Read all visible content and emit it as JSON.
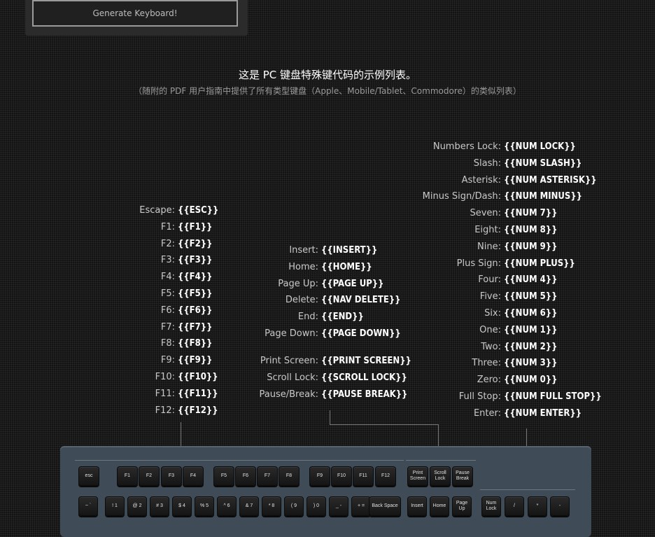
{
  "generate_button": "Generate Keyboard!",
  "headline": "这是 PC 键盘特殊键代码的示例列表。",
  "subline": "（随附的 PDF 用户指南中提供了所有类型键盘（Apple、Mobile/Tablet、Commodore）的类似列表）",
  "left_column": [
    {
      "label": "Escape:",
      "code": "{{ESC}}"
    },
    {
      "label": "F1:",
      "code": "{{F1}}"
    },
    {
      "label": "F2:",
      "code": "{{F2}}"
    },
    {
      "label": "F3:",
      "code": "{{F3}}"
    },
    {
      "label": "F4:",
      "code": "{{F4}}"
    },
    {
      "label": "F5:",
      "code": "{{F5}}"
    },
    {
      "label": "F6:",
      "code": "{{F6}}"
    },
    {
      "label": "F7:",
      "code": "{{F7}}"
    },
    {
      "label": "F8:",
      "code": "{{F8}}"
    },
    {
      "label": "F9:",
      "code": "{{F9}}"
    },
    {
      "label": "F10:",
      "code": "{{F10}}"
    },
    {
      "label": "F11:",
      "code": "{{F11}}"
    },
    {
      "label": "F12:",
      "code": "{{F12}}"
    }
  ],
  "middle_column": [
    {
      "label": "Insert:",
      "code": "{{INSERT}}"
    },
    {
      "label": "Home:",
      "code": "{{HOME}}"
    },
    {
      "label": "Page Up:",
      "code": "{{PAGE UP}}"
    },
    {
      "label": "Delete:",
      "code": "{{NAV DELETE}}"
    },
    {
      "label": "End:",
      "code": "{{END}}"
    },
    {
      "label": "Page Down:",
      "code": "{{PAGE DOWN}}"
    }
  ],
  "middle_column_2": [
    {
      "label": "Print Screen:",
      "code": "{{PRINT SCREEN}}"
    },
    {
      "label": "Scroll Lock:",
      "code": "{{SCROLL LOCK}}"
    },
    {
      "label": "Pause/Break:",
      "code": "{{PAUSE BREAK}}"
    }
  ],
  "right_column": [
    {
      "label": "Numbers Lock:",
      "code": "{{NUM LOCK}}"
    },
    {
      "label": "Slash:",
      "code": "{{NUM SLASH}}"
    },
    {
      "label": "Asterisk:",
      "code": "{{NUM ASTERISK}}"
    },
    {
      "label": "Minus Sign/Dash:",
      "code": "{{NUM MINUS}}"
    },
    {
      "label": "Seven:",
      "code": "{{NUM 7}}"
    },
    {
      "label": "Eight:",
      "code": "{{NUM 8}}"
    },
    {
      "label": "Nine:",
      "code": "{{NUM 9}}"
    },
    {
      "label": "Plus Sign:",
      "code": "{{NUM PLUS}}"
    },
    {
      "label": "Four:",
      "code": "{{NUM 4}}"
    },
    {
      "label": "Five:",
      "code": "{{NUM 5}}"
    },
    {
      "label": "Six:",
      "code": "{{NUM 6}}"
    },
    {
      "label": "One:",
      "code": "{{NUM 1}}"
    },
    {
      "label": "Two:",
      "code": "{{NUM 2}}"
    },
    {
      "label": "Three:",
      "code": "{{NUM 3}}"
    },
    {
      "label": "Zero:",
      "code": "{{NUM 0}}"
    },
    {
      "label": "Full Stop:",
      "code": "{{NUM FULL STOP}}"
    },
    {
      "label": "Enter:",
      "code": "{{NUM ENTER}}"
    }
  ],
  "keyboard": {
    "row1": [
      "esc",
      "F1",
      "F2",
      "F3",
      "F4",
      "F5",
      "F6",
      "F7",
      "F8",
      "F9",
      "F10",
      "F11",
      "F12",
      "Print Screen",
      "Scroll Lock",
      "Pause Break"
    ],
    "row2": [
      "~ `",
      "! 1",
      "@ 2",
      "# 3",
      "$ 4",
      "% 5",
      "^ 6",
      "& 7",
      "* 8",
      "( 9",
      ") 0",
      "_ -",
      "+ =",
      "Back Space",
      "Insert",
      "Home",
      "Page Up",
      "Num Lock",
      "/",
      "*",
      "-"
    ]
  }
}
